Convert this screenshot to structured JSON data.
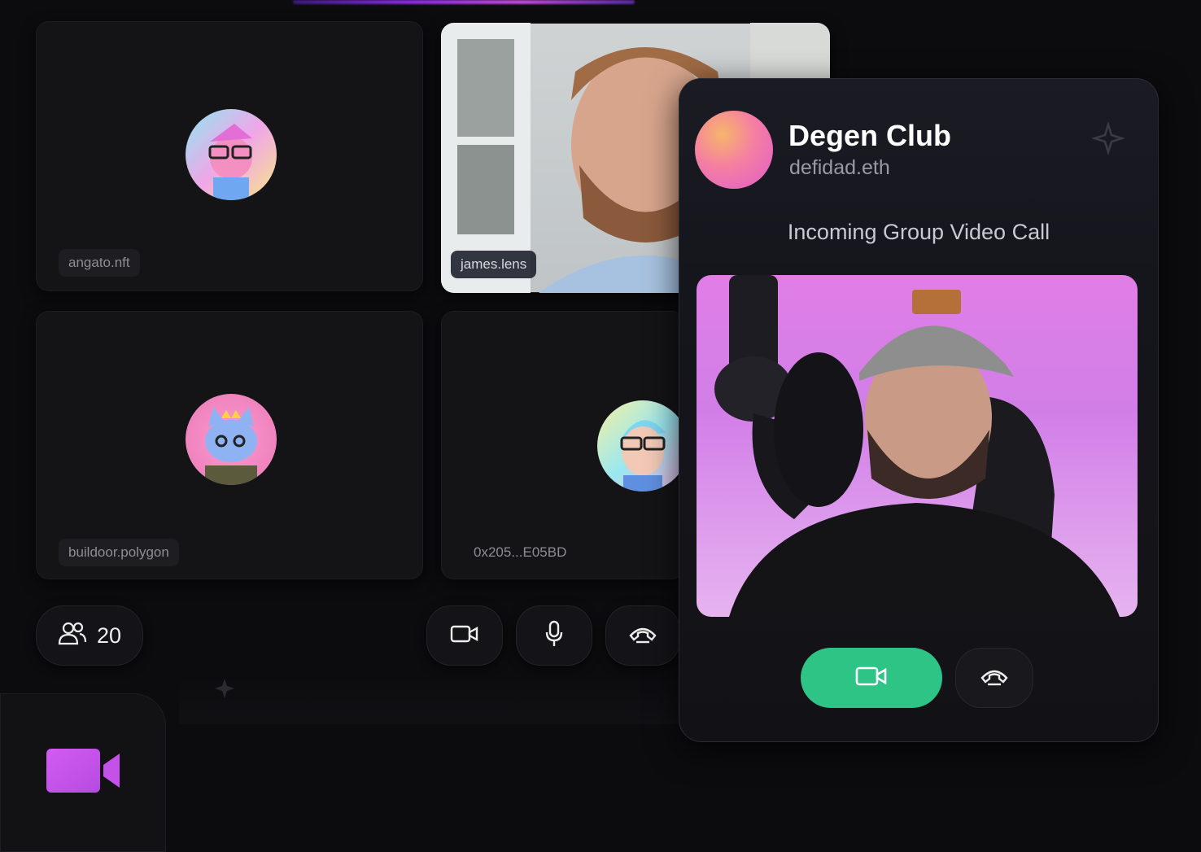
{
  "tiles": [
    {
      "label": "angato.nft"
    },
    {
      "label": "james.lens"
    },
    {
      "label": "buildoor.polygon"
    },
    {
      "label": "0x205...E05BD"
    }
  ],
  "participants": {
    "count": "20"
  },
  "call": {
    "title": "Degen Club",
    "subtitle": "defidad.eth",
    "message": "Incoming Group Video Call"
  },
  "colors": {
    "accent_green": "#2ec486",
    "brand_purple": "#c04bd8"
  },
  "icons": [
    "users-icon",
    "video-camera-icon",
    "microphone-icon",
    "hang-up-icon",
    "sparkle-icon",
    "app-video-icon"
  ]
}
